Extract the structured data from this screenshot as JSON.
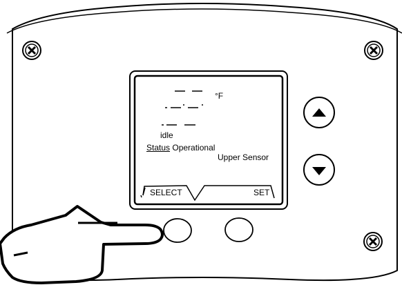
{
  "display": {
    "temp_unit": "°F",
    "mode": "idle",
    "status_label": "Status",
    "status_value": "Operational",
    "sensor": "Upper Sensor"
  },
  "softkeys": {
    "select_label": "SELECT",
    "set_label": "SET"
  },
  "buttons": {
    "up_icon": "triangle-up-icon",
    "down_icon": "triangle-down-icon"
  },
  "colors": {
    "line": "#000000",
    "background": "#ffffff"
  }
}
